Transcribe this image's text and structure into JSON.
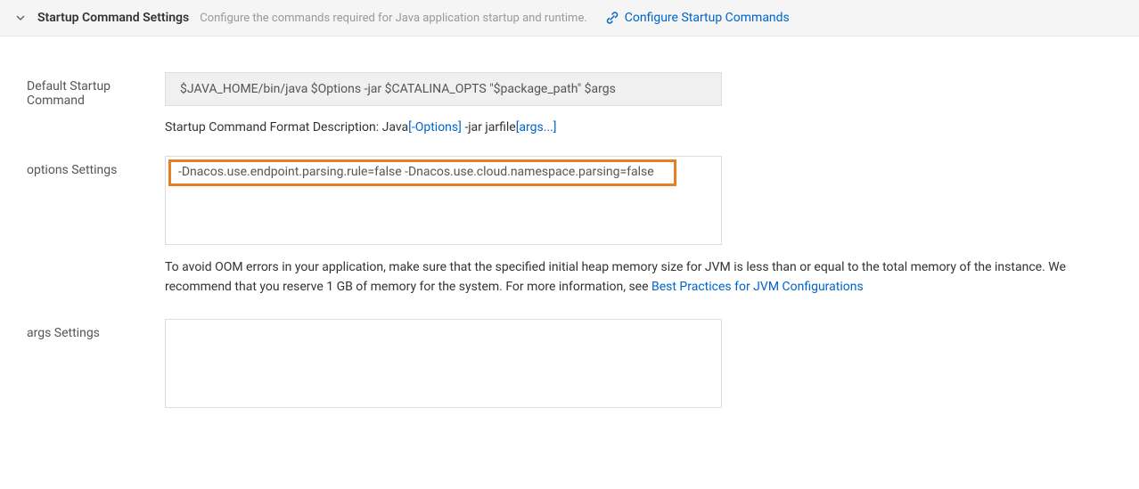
{
  "header": {
    "title": "Startup Command Settings",
    "description": "Configure the commands required for Java application startup and runtime.",
    "link_text": "Configure Startup Commands"
  },
  "labels": {
    "default_startup_command": "Default Startup Command",
    "options_settings": "options Settings",
    "args_settings": "args Settings"
  },
  "fields": {
    "default_command": "$JAVA_HOME/bin/java $Options -jar $CATALINA_OPTS \"$package_path\" $args",
    "options_value": "-Dnacos.use.endpoint.parsing.rule=false -Dnacos.use.cloud.namespace.parsing=false",
    "args_value": ""
  },
  "format_desc": {
    "prefix": "Startup Command Format Description: Java",
    "options_link": "[-Options]",
    "mid": " -jar jarfile",
    "args_link": "[args...]"
  },
  "warning": {
    "text": "To avoid OOM errors in your application, make sure that the specified initial heap memory size for JVM is less than or equal to the total memory of the instance. We recommend that you reserve 1 GB of memory for the system. For more information, see ",
    "link": "Best Practices for JVM Configurations"
  }
}
